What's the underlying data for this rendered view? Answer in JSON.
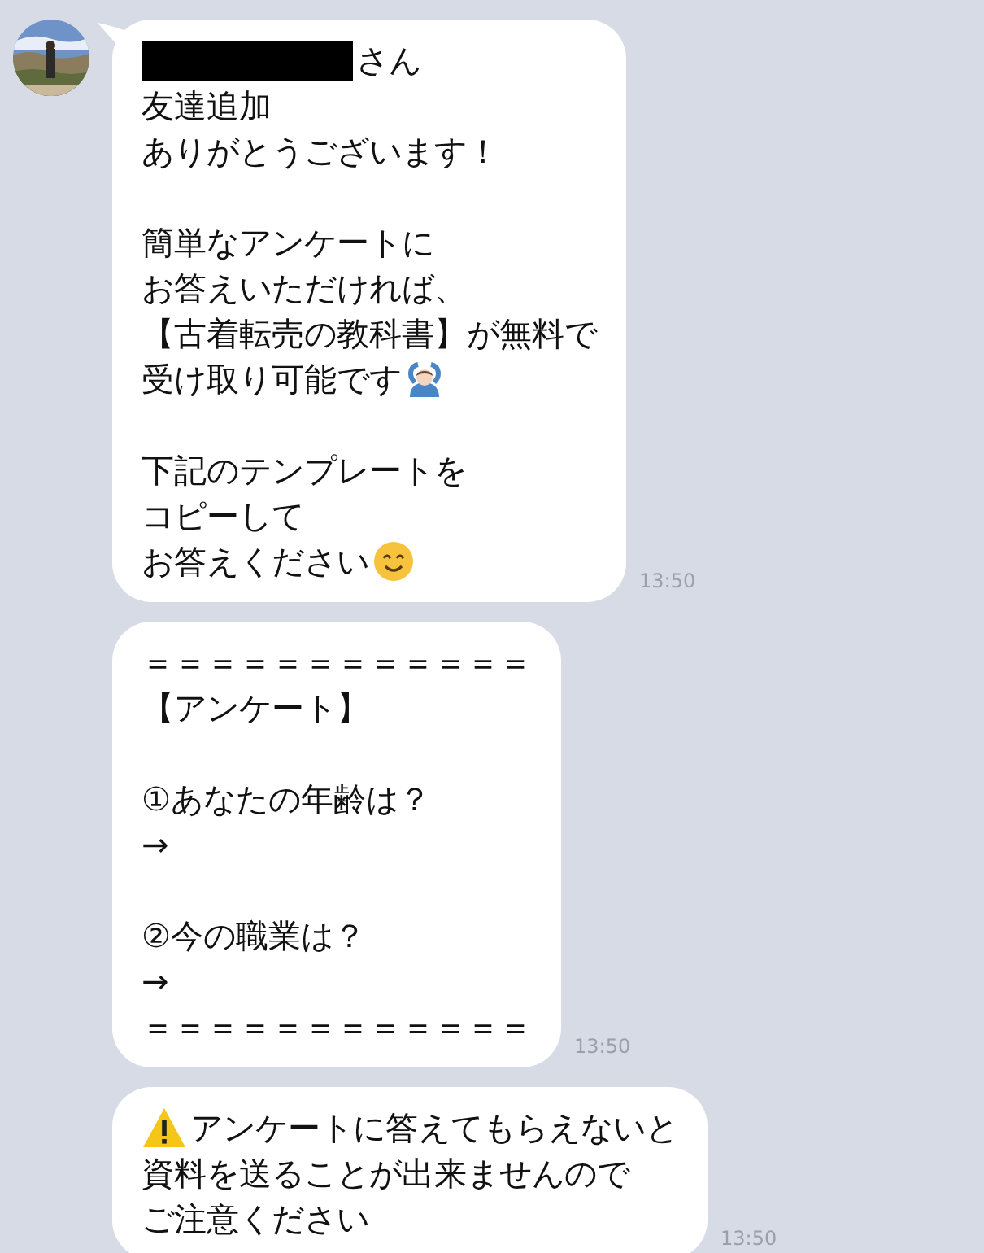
{
  "messages": [
    {
      "tail": true,
      "time": "13:50",
      "lines": [
        {
          "kind": "text",
          "redacted": true,
          "text": "さん"
        },
        {
          "kind": "text",
          "text": "友達追加"
        },
        {
          "kind": "text",
          "text": "ありがとうございます！"
        },
        {
          "kind": "blank"
        },
        {
          "kind": "text",
          "text": "簡単なアンケートに"
        },
        {
          "kind": "text",
          "text": "お答えいただければ、"
        },
        {
          "kind": "text",
          "text": "【古着転売の教科書】が無料で"
        },
        {
          "kind": "text",
          "text": "受け取り可能です",
          "icon_after": {
            "kind": "person"
          }
        },
        {
          "kind": "blank"
        },
        {
          "kind": "text",
          "text": "下記のテンプレートを"
        },
        {
          "kind": "text",
          "text": "コピーして"
        },
        {
          "kind": "text",
          "text": "お答えください",
          "icon_after": {
            "kind": "smile"
          }
        }
      ]
    },
    {
      "tail": false,
      "time": "13:50",
      "lines": [
        {
          "kind": "text",
          "text": "＝＝＝＝＝＝＝＝＝＝＝＝"
        },
        {
          "kind": "text",
          "text": "【アンケート】"
        },
        {
          "kind": "blank"
        },
        {
          "kind": "text",
          "text": "①あなたの年齢は？"
        },
        {
          "kind": "text",
          "text": "→"
        },
        {
          "kind": "blank"
        },
        {
          "kind": "text",
          "text": "②今の職業は？"
        },
        {
          "kind": "text",
          "text": "→"
        },
        {
          "kind": "text",
          "text": "＝＝＝＝＝＝＝＝＝＝＝＝"
        }
      ]
    },
    {
      "tail": false,
      "time": "13:50",
      "lines": [
        {
          "kind": "text",
          "text": "アンケートに答えてもらえないと",
          "icon_before": {
            "kind": "warning"
          }
        },
        {
          "kind": "text",
          "text": "資料を送ることが出来ませんので"
        },
        {
          "kind": "text",
          "text": "ご注意ください"
        }
      ]
    }
  ]
}
